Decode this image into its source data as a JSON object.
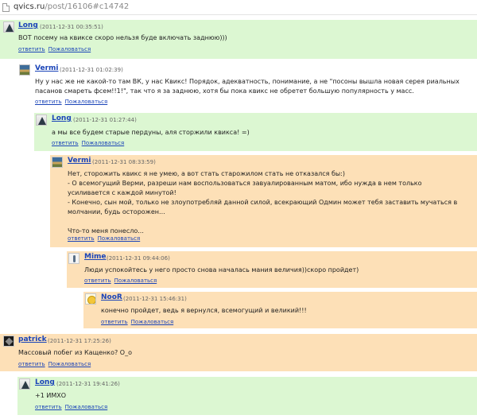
{
  "browser": {
    "url_host": "qvics.ru",
    "url_path": "/post/16106#c14742"
  },
  "comments": [
    {
      "author": "Long",
      "date": "(2011-12-31 00:35:51)",
      "text": "ВОТ посему на квиксе скоро нельзя буде включать заднюю)))",
      "reply": "ответить",
      "report": "Пожаловаться",
      "avatar_icon": "mountain-avatar-icon"
    },
    {
      "author": "Vermi",
      "date": "(2011-12-31 01:02:39)",
      "text": "Ну у нас же не какой-то там ВК, у нас Квикс! Порядок, адекватность, понимание, а не \"посоны вышла новая серея риальных пасанов смареть фсем!!1!\", так что я за заднюю, хотя бы пока квикс не обретет большую популярность у масс.",
      "reply": "ответить",
      "report": "Пожаловаться",
      "avatar_icon": "landscape-avatar-icon"
    },
    {
      "author": "Long",
      "date": "(2011-12-31 01:27:44)",
      "text": "а мы все будем старые пердуны, аля сторжили квикса! =)",
      "reply": "ответить",
      "report": "Пожаловаться",
      "avatar_icon": "mountain-avatar-icon"
    },
    {
      "author": "Vermi",
      "date": "(2011-12-31 08:33:59)",
      "lines": [
        "Нет, сторожить квикс я не умею, а вот стать старожилом стать не отказался бы:)",
        "- О всемогущий Верми, разреши нам воспользоваться завуалированным матом, ибо нужда в нем только усиливается с каждой минутой!",
        "- Конечно, сын мой, только не злоупотребляй данной силой, всекрающий Одмин может тебя заставить мучаться в молчании, будь осторожен...",
        "",
        "Что-то меня понесло..."
      ],
      "reply": "ответить",
      "report": "Пожаловаться",
      "avatar_icon": "landscape-avatar-icon"
    },
    {
      "author": "Mime",
      "date": "(2011-12-31 09:44:06)",
      "text": "Люди успокойтесь у него просто снова началась мания величия))скоро пройдет)",
      "reply": "ответить",
      "report": "Пожаловаться",
      "avatar_icon": "figure-avatar-icon"
    },
    {
      "author": "NooR",
      "date": "(2011-12-31 15:46:31)",
      "text": "конечно пройдет, ведь я вернулся, всемогущий и великий!!!",
      "reply": "ответить",
      "report": "Пожаловаться",
      "avatar_icon": "smiley-avatar-icon"
    },
    {
      "author": "patrick",
      "date": "(2011-12-31 17:25:26)",
      "text": "Массовый побег из Кащенко? О_о",
      "reply": "ответить",
      "report": "Пожаловаться",
      "avatar_icon": "dark-avatar-icon"
    },
    {
      "author": "Long",
      "date": "(2011-12-31 19:41:26)",
      "text": "+1 ИМХО",
      "reply": "ответить",
      "report": "Пожаловаться",
      "avatar_icon": "mountain-avatar-icon"
    }
  ],
  "colors": {
    "green": "#dcf7d2",
    "peach": "#fde0b7",
    "link": "#1a44b8"
  }
}
